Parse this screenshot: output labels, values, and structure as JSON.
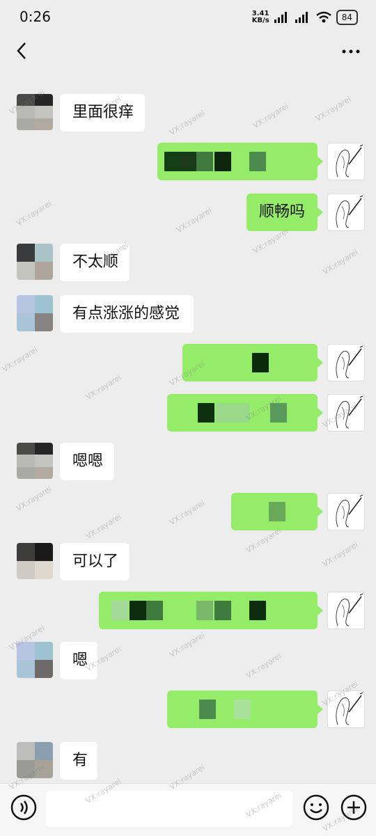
{
  "status_bar": {
    "time": "0:26",
    "net_speed_value": "3.41",
    "net_speed_unit": "KB/s",
    "battery": "84"
  },
  "watermark": "VX:rayarei",
  "messages": [
    {
      "dir": "in",
      "text": "里面很痒"
    },
    {
      "dir": "out",
      "text": "",
      "pixelated": true
    },
    {
      "dir": "out",
      "text": "顺畅吗"
    },
    {
      "dir": "in",
      "text": "不太顺"
    },
    {
      "dir": "in",
      "text": "有点涨涨的感觉"
    },
    {
      "dir": "out",
      "text": "",
      "pixelated": true
    },
    {
      "dir": "out",
      "text": "",
      "pixelated": true
    },
    {
      "dir": "in",
      "text": "嗯嗯"
    },
    {
      "dir": "out",
      "text": "",
      "pixelated": true
    },
    {
      "dir": "in",
      "text": "可以了"
    },
    {
      "dir": "out",
      "text": "",
      "pixelated": true
    },
    {
      "dir": "in",
      "text": "嗯"
    },
    {
      "dir": "out",
      "text": "",
      "pixelated": true
    },
    {
      "dir": "in",
      "text": "有"
    }
  ],
  "colors": {
    "background": "#ededed",
    "outgoing_bubble": "#95ec69",
    "incoming_bubble": "#ffffff"
  }
}
